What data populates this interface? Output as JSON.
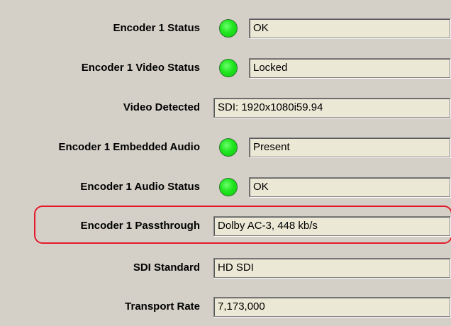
{
  "rows": [
    {
      "label": "Encoder 1 Status",
      "value": "OK",
      "indicator": "ok"
    },
    {
      "label": "Encoder 1 Video Status",
      "value": "Locked",
      "indicator": "ok"
    },
    {
      "label": "Video Detected",
      "value": "SDI: 1920x1080i59.94"
    },
    {
      "label": "Encoder 1 Embedded Audio",
      "value": "Present",
      "indicator": "ok"
    },
    {
      "label": "Encoder 1 Audio Status",
      "value": "OK",
      "indicator": "ok"
    },
    {
      "label": "Encoder 1 Passthrough",
      "value": "Dolby AC-3, 448 kb/s",
      "highlighted": true
    },
    {
      "label": "SDI Standard",
      "value": "HD SDI"
    },
    {
      "label": "Transport Rate",
      "value": "7,173,000"
    }
  ],
  "colors": {
    "background": "#d4d0c8",
    "field_background": "#ebe8d5",
    "indicator_ok": "#1fe51f",
    "highlight": "#e31b2c"
  }
}
